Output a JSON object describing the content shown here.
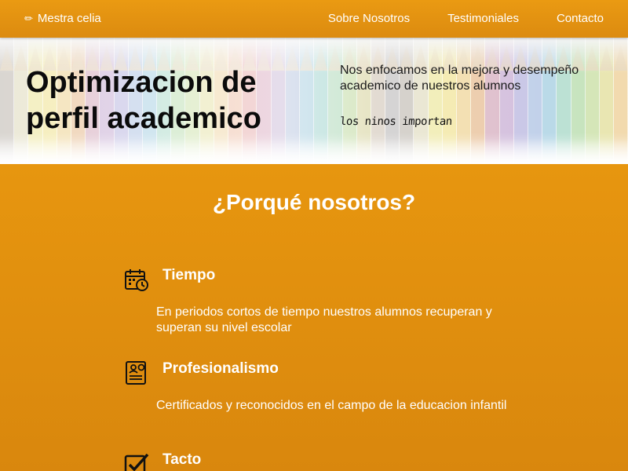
{
  "nav": {
    "brand_icon": "pencil-icon",
    "brand": "Mestra celia",
    "links": [
      "Sobre Nosotros",
      "Testimoniales",
      "Contacto"
    ]
  },
  "hero": {
    "title": "Optimizacion de perfil academico",
    "subtitle": "Nos enfocamos en la mejora y desempeño academico de nuestros alumnos",
    "tagline": "los ninos importan",
    "background": "colored-pencils-image"
  },
  "why": {
    "title": "¿Porqué nosotros?",
    "features": [
      {
        "icon": "calendar-clock-icon",
        "title": "Tiempo",
        "text": "En periodos cortos de tiempo nuestros alumnos recuperan y superan su nivel escolar"
      },
      {
        "icon": "certificate-icon",
        "title": "Profesionalismo",
        "text": "Certificados y reconocidos en el campo de la educacion infantil"
      },
      {
        "icon": "checkbox-icon",
        "title": "Tacto",
        "text": ""
      }
    ]
  },
  "colors": {
    "accent": "#e0930f",
    "nav": "#e6950f",
    "text_on_accent": "#ffffff"
  }
}
